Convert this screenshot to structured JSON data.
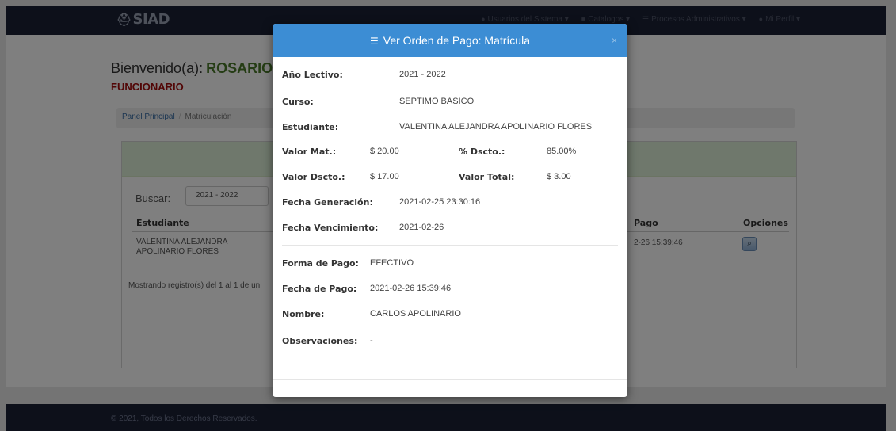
{
  "navbar": {
    "brand": "SIAD",
    "menu": [
      "Usuarios del Sistema ▾",
      "Catalogos ▾",
      "Procesos Administrativos ▾",
      "Mi Perfil ▾"
    ]
  },
  "page": {
    "welcome_label": "Bienvenido(a):",
    "welcome_name": "ROSARIO",
    "role": "FUNCIONARIO",
    "breadcrumb": [
      "Panel Principal",
      "Matriculación"
    ],
    "search_label": "Buscar:",
    "search_value": "2021 - 2022",
    "table": {
      "headers": [
        "Estudiante",
        "Pago",
        "Opciones"
      ],
      "rows": [
        {
          "estudiante": "VALENTINA ALEJANDRA APOLINARIO FLORES",
          "pago": "2-26 15:39:46"
        }
      ]
    },
    "records_text": "Mostrando registro(s) del 1 al 1 de un"
  },
  "footer": {
    "text": "© 2021, Todos los Derechos Reservados."
  },
  "modal": {
    "title": "Ver Orden de Pago: Matrícula",
    "close": "×",
    "fields": {
      "anio_lectivo": {
        "label": "Año Lectivo:",
        "value": "2021 - 2022"
      },
      "curso": {
        "label": "Curso:",
        "value": "SEPTIMO BASICO"
      },
      "estudiante": {
        "label": "Estudiante:",
        "value": "VALENTINA ALEJANDRA APOLINARIO FLORES"
      },
      "valor_mat": {
        "label": "Valor Mat.:",
        "value": "$ 20.00"
      },
      "pct_dscto": {
        "label": "% Dscto.:",
        "value": "85.00%"
      },
      "valor_dscto": {
        "label": "Valor Dscto.:",
        "value": "$ 17.00"
      },
      "valor_total": {
        "label": "Valor Total:",
        "value": "$ 3.00"
      },
      "fecha_generacion": {
        "label": "Fecha Generación:",
        "value": "2021-02-25 23:30:16"
      },
      "fecha_vencimiento": {
        "label": "Fecha Vencimiento:",
        "value": "2021-02-26"
      },
      "forma_pago": {
        "label": "Forma de Pago:",
        "value": "EFECTIVO"
      },
      "fecha_pago": {
        "label": "Fecha de Pago:",
        "value": "2021-02-26 15:39:46"
      },
      "nombre": {
        "label": "Nombre:",
        "value": "CARLOS APOLINARIO"
      },
      "observaciones": {
        "label": "Observaciones:",
        "value": "-"
      }
    }
  }
}
